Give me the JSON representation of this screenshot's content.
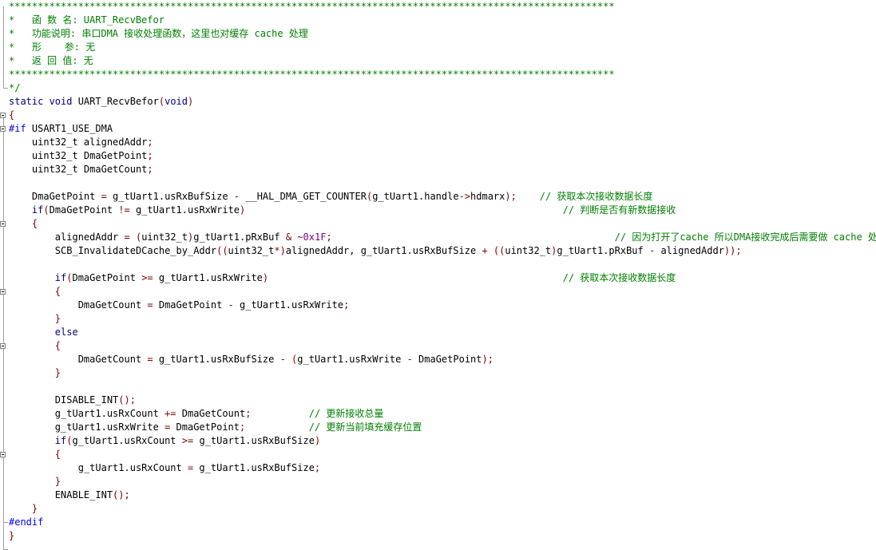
{
  "colors": {
    "comment": "#008000",
    "keyword": "#000080",
    "operator": "#800000",
    "number": "#800080",
    "preprocessor": "#0000ff",
    "plain": "#000000",
    "background": "#ffffff"
  },
  "lines": [
    [
      {
        "t": "*********************************************************************************************************",
        "c": "comment"
      }
    ],
    [
      {
        "t": "*   函 数 名: UART_RecvBefor",
        "c": "comment"
      }
    ],
    [
      {
        "t": "*   功能说明: 串口DMA 接收处理函数，这里也对缓存 cache 处理",
        "c": "comment"
      }
    ],
    [
      {
        "t": "*   形    参: 无",
        "c": "comment"
      }
    ],
    [
      {
        "t": "*   返 回 值: 无",
        "c": "comment"
      }
    ],
    [
      {
        "t": "*********************************************************************************************************",
        "c": "comment"
      }
    ],
    [
      {
        "t": "*/",
        "c": "comment"
      }
    ],
    [
      {
        "t": "static void ",
        "c": "keyword"
      },
      {
        "t": "UART_RecvBefor",
        "c": "plain"
      },
      {
        "t": "(",
        "c": "op"
      },
      {
        "t": "void",
        "c": "keyword"
      },
      {
        "t": ")",
        "c": "op"
      }
    ],
    [
      {
        "t": "{",
        "c": "op"
      }
    ],
    [
      {
        "t": "#if ",
        "c": "preproc"
      },
      {
        "t": "USART1_USE_DMA",
        "c": "plain"
      }
    ],
    [
      {
        "t": "    uint32_t alignedAddr",
        "c": "plain"
      },
      {
        "t": ";",
        "c": "op"
      }
    ],
    [
      {
        "t": "    uint32_t DmaGetPoint",
        "c": "plain"
      },
      {
        "t": ";",
        "c": "op"
      }
    ],
    [
      {
        "t": "    uint32_t DmaGetCount",
        "c": "plain"
      },
      {
        "t": ";",
        "c": "op"
      }
    ],
    [
      {
        "t": "",
        "c": "plain"
      }
    ],
    [
      {
        "t": "    DmaGetPoint ",
        "c": "plain"
      },
      {
        "t": "=",
        "c": "op"
      },
      {
        "t": " g_tUart1.usRxBufSize ",
        "c": "plain"
      },
      {
        "t": "-",
        "c": "op"
      },
      {
        "t": " __HAL_DMA_GET_COUNTER",
        "c": "plain"
      },
      {
        "t": "(",
        "c": "op"
      },
      {
        "t": "g_tUart1.handle",
        "c": "plain"
      },
      {
        "t": "->",
        "c": "op"
      },
      {
        "t": "hdmarx",
        "c": "plain"
      },
      {
        "t": ");",
        "c": "op"
      },
      {
        "t": "    // 获取本次接收数据长度",
        "c": "comment"
      }
    ],
    [
      {
        "t": "    ",
        "c": "plain"
      },
      {
        "t": "if",
        "c": "keyword"
      },
      {
        "t": "(",
        "c": "op"
      },
      {
        "t": "DmaGetPoint ",
        "c": "plain"
      },
      {
        "t": "!=",
        "c": "op"
      },
      {
        "t": " g_tUart1.usRxWrite",
        "c": "plain"
      },
      {
        "t": ")",
        "c": "op"
      },
      {
        "t": "                                                       // 判断是否有新数据接收",
        "c": "comment"
      }
    ],
    [
      {
        "t": "    {",
        "c": "op"
      }
    ],
    [
      {
        "t": "        alignedAddr ",
        "c": "plain"
      },
      {
        "t": "=",
        "c": "op"
      },
      {
        "t": " ",
        "c": "plain"
      },
      {
        "t": "(",
        "c": "op"
      },
      {
        "t": "uint32_t",
        "c": "plain"
      },
      {
        "t": ")",
        "c": "op"
      },
      {
        "t": "g_tUart1.pRxBuf ",
        "c": "plain"
      },
      {
        "t": "& ~",
        "c": "op"
      },
      {
        "t": "0x1F",
        "c": "number"
      },
      {
        "t": ";",
        "c": "op"
      },
      {
        "t": "                                                 // 因为打开了cache 所以DMA接收完成后需要做 cache 处理",
        "c": "comment"
      }
    ],
    [
      {
        "t": "        SCB_InvalidateDCache_by_Addr",
        "c": "plain"
      },
      {
        "t": "((",
        "c": "op"
      },
      {
        "t": "uint32_t",
        "c": "plain"
      },
      {
        "t": "*)",
        "c": "op"
      },
      {
        "t": "alignedAddr, g_tUart1.usRxBufSize ",
        "c": "plain"
      },
      {
        "t": "+",
        "c": "op"
      },
      {
        "t": " ",
        "c": "plain"
      },
      {
        "t": "((",
        "c": "op"
      },
      {
        "t": "uint32_t",
        "c": "plain"
      },
      {
        "t": ")",
        "c": "op"
      },
      {
        "t": "g_tUart1.pRxBuf ",
        "c": "plain"
      },
      {
        "t": "-",
        "c": "op"
      },
      {
        "t": " alignedAddr",
        "c": "plain"
      },
      {
        "t": "));",
        "c": "op"
      }
    ],
    [
      {
        "t": "",
        "c": "plain"
      }
    ],
    [
      {
        "t": "        ",
        "c": "plain"
      },
      {
        "t": "if",
        "c": "keyword"
      },
      {
        "t": "(",
        "c": "op"
      },
      {
        "t": "DmaGetPoint ",
        "c": "plain"
      },
      {
        "t": ">=",
        "c": "op"
      },
      {
        "t": " g_tUart1.usRxWrite",
        "c": "plain"
      },
      {
        "t": ")",
        "c": "op"
      },
      {
        "t": "                                                   // 获取本次接收数据长度",
        "c": "comment"
      }
    ],
    [
      {
        "t": "        {",
        "c": "op"
      }
    ],
    [
      {
        "t": "            DmaGetCount ",
        "c": "plain"
      },
      {
        "t": "=",
        "c": "op"
      },
      {
        "t": " DmaGetPoint ",
        "c": "plain"
      },
      {
        "t": "-",
        "c": "op"
      },
      {
        "t": " g_tUart1.usRxWrite",
        "c": "plain"
      },
      {
        "t": ";",
        "c": "op"
      }
    ],
    [
      {
        "t": "        }",
        "c": "op"
      }
    ],
    [
      {
        "t": "        ",
        "c": "plain"
      },
      {
        "t": "else",
        "c": "keyword"
      }
    ],
    [
      {
        "t": "        {",
        "c": "op"
      }
    ],
    [
      {
        "t": "            DmaGetCount ",
        "c": "plain"
      },
      {
        "t": "=",
        "c": "op"
      },
      {
        "t": " g_tUart1.usRxBufSize ",
        "c": "plain"
      },
      {
        "t": "-",
        "c": "op"
      },
      {
        "t": " ",
        "c": "plain"
      },
      {
        "t": "(",
        "c": "op"
      },
      {
        "t": "g_tUart1.usRxWrite ",
        "c": "plain"
      },
      {
        "t": "-",
        "c": "op"
      },
      {
        "t": " DmaGetPoint",
        "c": "plain"
      },
      {
        "t": ");",
        "c": "op"
      }
    ],
    [
      {
        "t": "        }",
        "c": "op"
      }
    ],
    [
      {
        "t": "",
        "c": "plain"
      }
    ],
    [
      {
        "t": "        DISABLE_INT",
        "c": "plain"
      },
      {
        "t": "();",
        "c": "op"
      }
    ],
    [
      {
        "t": "        g_tUart1.usRxCount ",
        "c": "plain"
      },
      {
        "t": "+=",
        "c": "op"
      },
      {
        "t": " DmaGetCount",
        "c": "plain"
      },
      {
        "t": ";",
        "c": "op"
      },
      {
        "t": "          // 更新接收总量",
        "c": "comment"
      }
    ],
    [
      {
        "t": "        g_tUart1.usRxWrite ",
        "c": "plain"
      },
      {
        "t": "=",
        "c": "op"
      },
      {
        "t": " DmaGetPoint",
        "c": "plain"
      },
      {
        "t": ";",
        "c": "op"
      },
      {
        "t": "           // 更新当前填充缓存位置",
        "c": "comment"
      }
    ],
    [
      {
        "t": "        ",
        "c": "plain"
      },
      {
        "t": "if",
        "c": "keyword"
      },
      {
        "t": "(",
        "c": "op"
      },
      {
        "t": "g_tUart1.usRxCount ",
        "c": "plain"
      },
      {
        "t": ">=",
        "c": "op"
      },
      {
        "t": " g_tUart1.usRxBufSize",
        "c": "plain"
      },
      {
        "t": ")",
        "c": "op"
      }
    ],
    [
      {
        "t": "        {",
        "c": "op"
      }
    ],
    [
      {
        "t": "            g_tUart1.usRxCount ",
        "c": "plain"
      },
      {
        "t": "=",
        "c": "op"
      },
      {
        "t": " g_tUart1.usRxBufSize",
        "c": "plain"
      },
      {
        "t": ";",
        "c": "op"
      }
    ],
    [
      {
        "t": "        }",
        "c": "op"
      }
    ],
    [
      {
        "t": "        ENABLE_INT",
        "c": "plain"
      },
      {
        "t": "();",
        "c": "op"
      }
    ],
    [
      {
        "t": "    }",
        "c": "op"
      }
    ],
    [
      {
        "t": "#endif",
        "c": "preproc"
      }
    ],
    [
      {
        "t": "}",
        "c": "op"
      }
    ]
  ]
}
